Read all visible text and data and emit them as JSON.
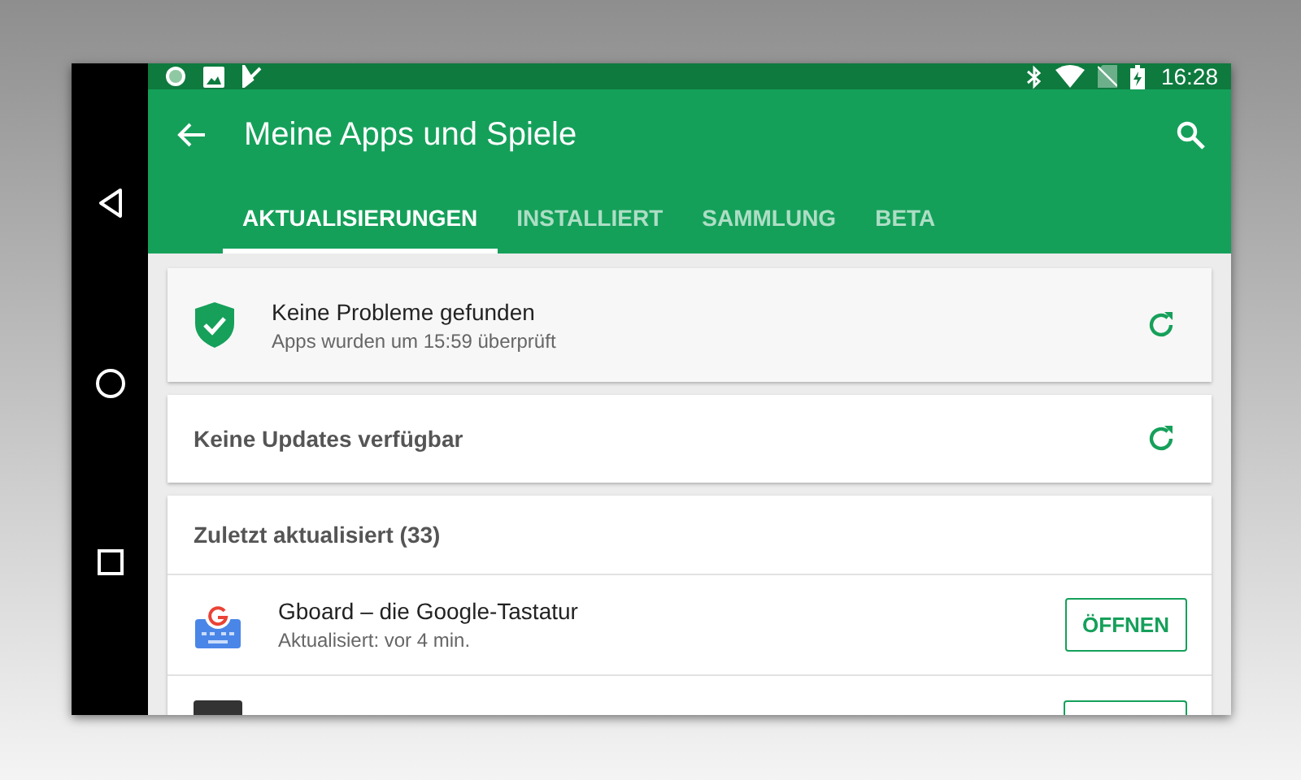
{
  "status_bar": {
    "time": "16:28"
  },
  "app_bar": {
    "title": "Meine Apps und Spiele"
  },
  "tabs": [
    {
      "label": "AKTUALISIERUNGEN",
      "selected": true
    },
    {
      "label": "INSTALLIERT",
      "selected": false
    },
    {
      "label": "SAMMLUNG",
      "selected": false
    },
    {
      "label": "BETA",
      "selected": false
    }
  ],
  "security_card": {
    "title": "Keine Probleme gefunden",
    "subtitle": "Apps wurden um 15:59 überprüft"
  },
  "updates_card": {
    "text": "Keine Updates verfügbar"
  },
  "recent": {
    "header": "Zuletzt aktualisiert (33)",
    "apps": [
      {
        "kind": "full",
        "name": "Gboard – die Google-Tastatur",
        "status": "Aktualisiert: vor 4 min.",
        "button": "ÖFFNEN"
      },
      {
        "kind": "partial"
      }
    ]
  }
}
